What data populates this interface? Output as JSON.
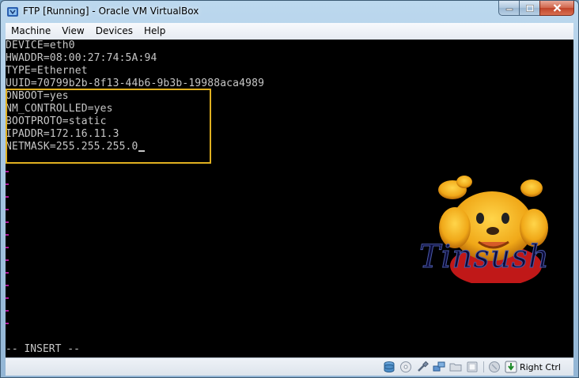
{
  "window": {
    "title": "FTP [Running] - Oracle VM VirtualBox"
  },
  "menu": [
    {
      "label": "Machine"
    },
    {
      "label": "View"
    },
    {
      "label": "Devices"
    },
    {
      "label": "Help"
    }
  ],
  "console": {
    "lines": [
      "DEVICE=eth0",
      "HWADDR=08:00:27:74:5A:94",
      "TYPE=Ethernet",
      "UUID=70799b2b-8f13-44b6-9b3b-19988aca4989",
      "ONBOOT=yes",
      "NM_CONTROLLED=yes",
      "BOOTPROTO=static",
      "IPADDR=172.16.11.3",
      "NETMASK=255.255.255.0"
    ],
    "mode": "-- INSERT --",
    "watermark": "Tinsush"
  },
  "status": {
    "host_key": "Right Ctrl"
  },
  "icons": {
    "app": "virtualbox-icon",
    "status": [
      "hard-disk-icon",
      "optical-drive-icon",
      "usb-icon",
      "network-icon",
      "shared-folders-icon",
      "display-icon",
      "capture-icon",
      "host-key-icon"
    ]
  },
  "colors": {
    "highlight": "#e0b020",
    "terminal_bg": "#000000",
    "terminal_fg": "#c6c6c6",
    "tilde": "#b01a9a"
  }
}
